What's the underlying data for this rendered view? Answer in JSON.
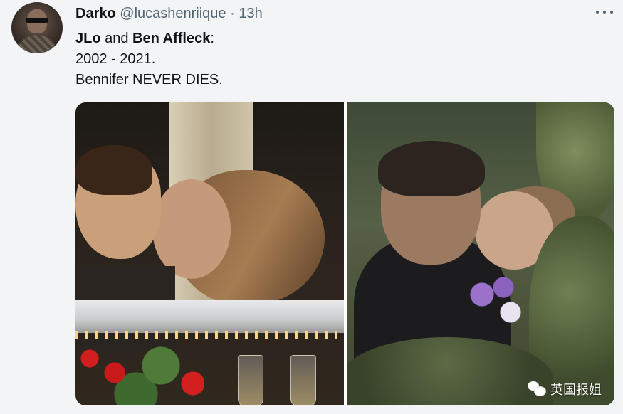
{
  "tweet": {
    "author": {
      "display_name": "Darko",
      "handle": "@lucashenriique"
    },
    "separator": "·",
    "timestamp": "13h",
    "more_icon": "more-horizontal-icon",
    "text": {
      "line1_bold_1": "JLo",
      "line1_connector": " and ",
      "line1_bold_2": "Ben Affleck",
      "line1_suffix": ":",
      "line2": "2002 - 2021.",
      "line3": "Bennifer NEVER DIES."
    },
    "media": {
      "watermark_text": "英国报姐",
      "watermark_icon": "wechat-icon"
    }
  }
}
